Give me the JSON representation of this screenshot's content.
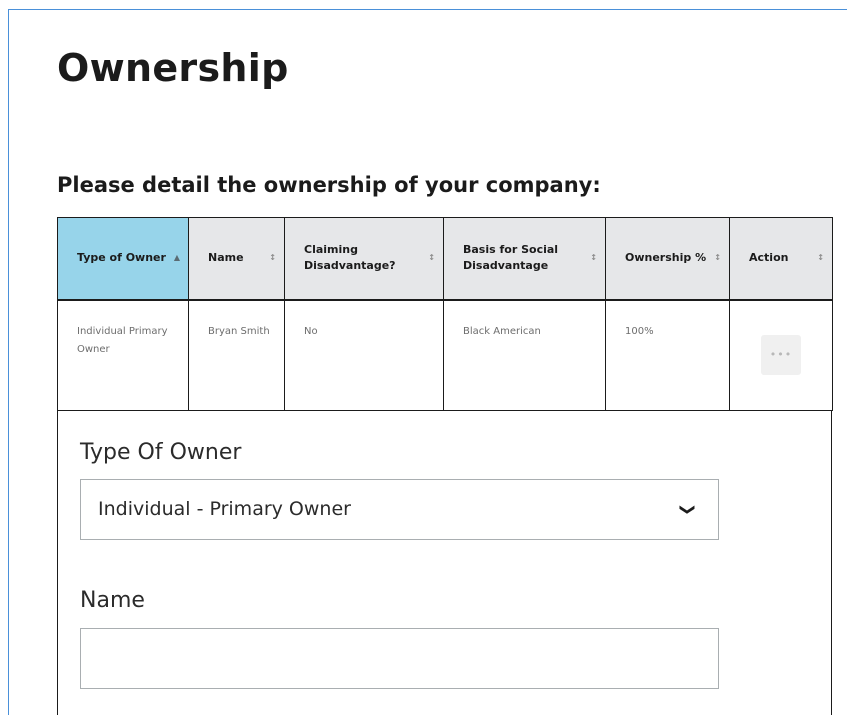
{
  "page": {
    "title": "Ownership",
    "section_heading": "Please detail the ownership of your company:"
  },
  "table": {
    "sorted_column": 0,
    "columns": [
      {
        "label": "Type of Owner"
      },
      {
        "label": "Name"
      },
      {
        "label": "Claiming Disadvantage?"
      },
      {
        "label": "Basis for Social Disadvantage"
      },
      {
        "label": "Ownership %"
      },
      {
        "label": "Action"
      }
    ],
    "rows": [
      {
        "type_of_owner": "Individual Primary Owner",
        "name": "Bryan Smith",
        "claiming_disadvantage": "No",
        "basis": "Black American",
        "ownership": "100%",
        "action_icon": "more-horizontal-icon"
      }
    ]
  },
  "form": {
    "type_of_owner_label": "Type Of Owner",
    "type_of_owner_value": "Individual - Primary Owner",
    "name_label": "Name",
    "name_value": "",
    "chevron_icon": "chevron-down-icon"
  },
  "colors": {
    "sorted_header": "#97d4ea",
    "header": "#e6e7e9",
    "frame_border": "#4a90d9"
  }
}
